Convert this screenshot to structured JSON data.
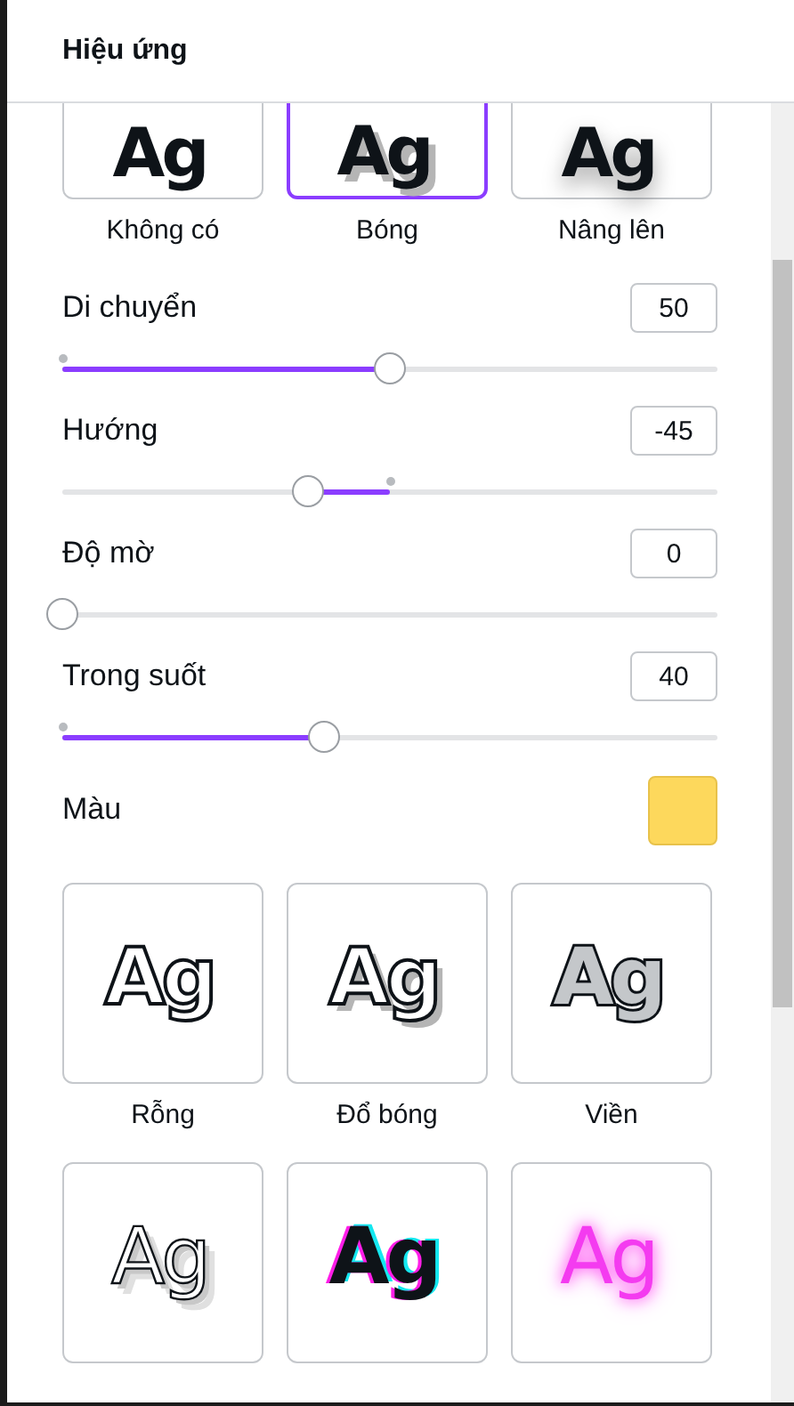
{
  "panel": {
    "title": "Hiệu ứng"
  },
  "effects_top": [
    {
      "preview": "Ag",
      "label": "Không có",
      "kind": "none",
      "selected": false
    },
    {
      "preview": "Ag",
      "label": "Bóng",
      "kind": "shadow",
      "selected": true
    },
    {
      "preview": "Ag",
      "label": "Nâng lên",
      "kind": "lift",
      "selected": false
    }
  ],
  "sliders": [
    {
      "label": "Di chuyển",
      "value": "50",
      "level": 0.5,
      "kind": "plain"
    },
    {
      "label": "Hướng",
      "value": "-45",
      "level": 0.375,
      "kind": "bipolar"
    },
    {
      "label": "Độ mờ",
      "value": "0",
      "level": 0,
      "kind": "plain"
    },
    {
      "label": "Trong suốt",
      "value": "40",
      "level": 0.4,
      "kind": "plain"
    }
  ],
  "color": {
    "label": "Màu",
    "color": "#fdd85c"
  },
  "effects": [
    {
      "preview": "Ag",
      "label": "Rỗng",
      "kind": "hollow",
      "selected": false
    },
    {
      "preview": "Ag",
      "label": "Đổ bóng",
      "kind": "splice",
      "selected": false
    },
    {
      "preview": "Ag",
      "label": "Viền",
      "kind": "outline",
      "selected": false
    },
    {
      "preview": "Ag",
      "kind": "echo",
      "selected": false
    },
    {
      "preview": "Ag",
      "kind": "glitch",
      "selected": false
    },
    {
      "preview": "Ag",
      "kind": "neon",
      "selected": false
    }
  ]
}
